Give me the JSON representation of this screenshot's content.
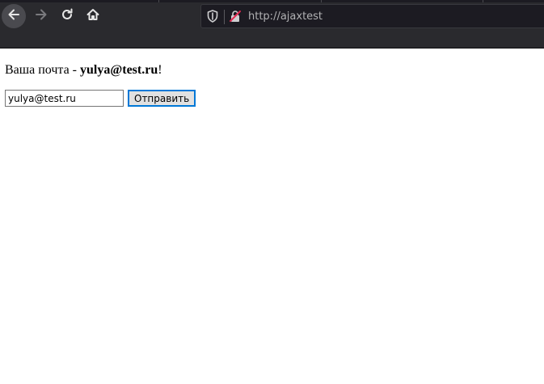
{
  "browser": {
    "url": "http://ajaxtest",
    "icons": {
      "back": "back-arrow-icon",
      "forward": "forward-arrow-icon",
      "reload": "reload-icon",
      "home": "home-icon",
      "tracking": "shield-icon",
      "insecure": "insecure-lock-icon"
    }
  },
  "page": {
    "greeting_prefix": "Ваша почта - ",
    "email_display": "yulya@test.ru",
    "greeting_suffix": "!",
    "email_input_value": "yulya@test.ru",
    "submit_label": "Отправить"
  },
  "colors": {
    "toolbar_bg": "#2a2a2e",
    "url_text": "#b1b1b3",
    "button_focus_border": "#0078d7"
  }
}
